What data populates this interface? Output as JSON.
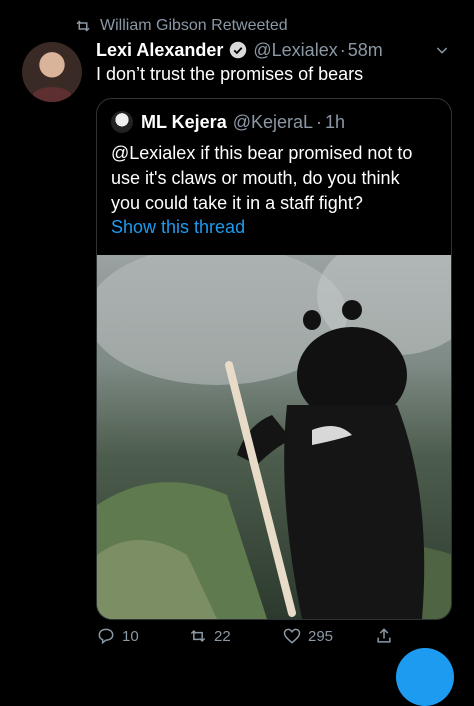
{
  "retweet": {
    "text": "William Gibson Retweeted"
  },
  "tweet": {
    "author_name": "Lexi Alexander",
    "handle": "@Lexialex",
    "separator": "·",
    "time": "58m",
    "text": "I don’t trust the promises of bears"
  },
  "quote": {
    "author_name": "ML Kejera",
    "handle": "@KejeraL",
    "separator": "·",
    "time": "1h",
    "lines": [
      "@Lexialex if this bear promised not to",
      "use it's claws or mouth, do you think",
      "you could take it in a staff fight?"
    ],
    "show_thread": "Show this thread"
  },
  "actions": {
    "replies": "10",
    "retweets": "22",
    "likes": "295"
  },
  "colors": {
    "background": "#000000",
    "muted": "#8b98a5",
    "link": "#1d9bf0",
    "border": "#2f3336"
  },
  "icons": [
    "retweet-icon",
    "verified-badge-icon",
    "chevron-down-icon",
    "reply-icon",
    "like-icon",
    "share-icon"
  ]
}
